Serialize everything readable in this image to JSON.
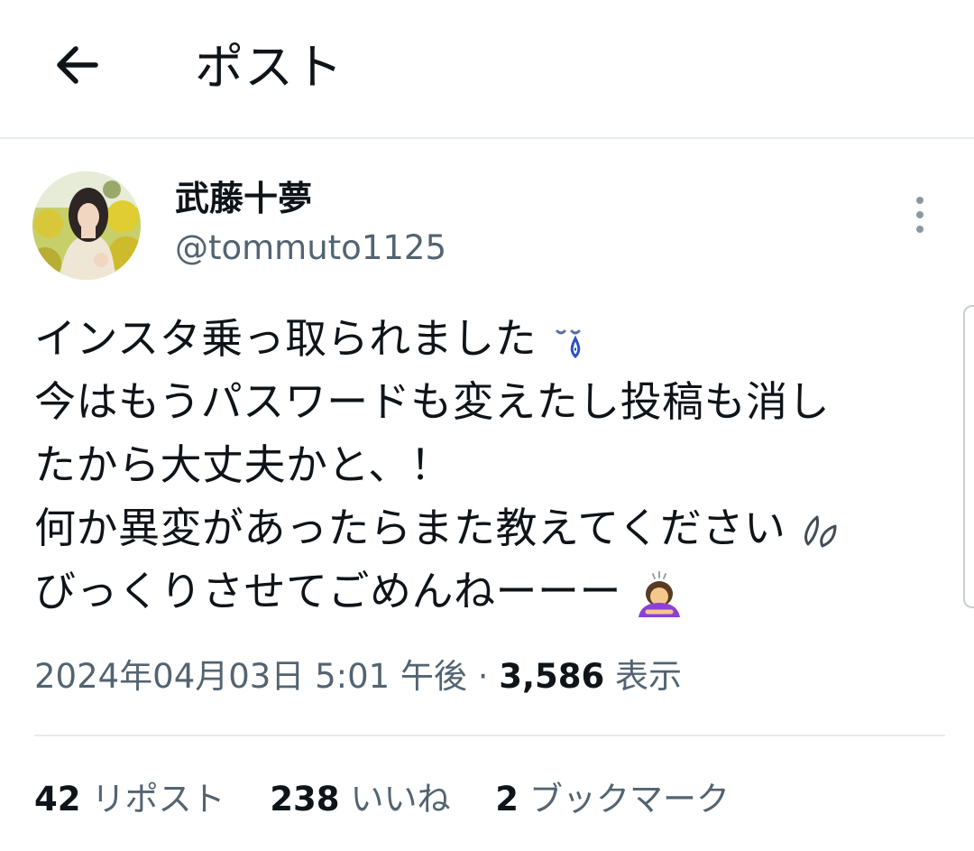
{
  "header": {
    "title": "ポスト"
  },
  "author": {
    "display_name": "武藤十夢",
    "handle": "@tommuto1125"
  },
  "tweet": {
    "lines": [
      "インスタ乗っ取られました",
      "今はもうパスワードも変えたし投稿も消し",
      "たから大丈夫かと、！",
      "何か異変があったらまた教えてください",
      "びっくりさせてごめんねーーー"
    ]
  },
  "meta": {
    "timestamp": "2024年04月03日 5:01 午後",
    "separator": "·",
    "views_count": "3,586",
    "views_label": "表示"
  },
  "stats": {
    "reposts_count": "42",
    "reposts_label": "リポスト",
    "likes_count": "238",
    "likes_label": "いいね",
    "bookmarks_count": "2",
    "bookmarks_label": "ブックマーク"
  },
  "icons": {
    "back": "arrow-left-icon",
    "more": "vertical-dots-icon",
    "tear_emoji": "crying-face-icon",
    "sweat_emoji": "sweat-drops-icon",
    "bow_emoji": "person-bowing-icon"
  },
  "colors": {
    "text_primary": "#0f1419",
    "text_secondary": "#536471",
    "divider": "#e8ebee"
  }
}
